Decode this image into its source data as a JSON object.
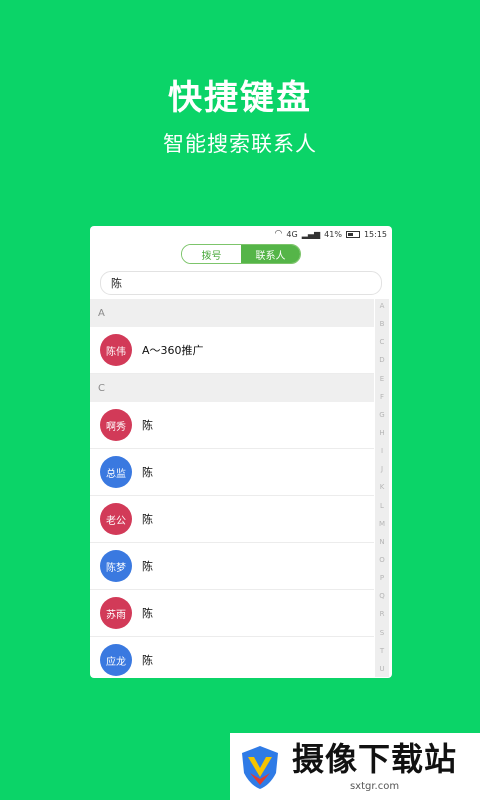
{
  "hero": {
    "title": "快捷键盘",
    "subtitle": "智能搜索联系人"
  },
  "status_bar": {
    "network": "4G",
    "battery": "41%",
    "time": "15:15"
  },
  "tabs": [
    {
      "label": "拨号",
      "active": false
    },
    {
      "label": "联系人",
      "active": true
    }
  ],
  "search": {
    "value": "陈"
  },
  "sections": [
    {
      "letter": "A",
      "contacts": [
        {
          "avatar": "陈伟",
          "name": "A～360推广",
          "color": "#d23a58"
        }
      ]
    },
    {
      "letter": "C",
      "contacts": [
        {
          "avatar": "啊秀",
          "name": "陈",
          "color": "#d23a58"
        },
        {
          "avatar": "总监",
          "name": "陈",
          "color": "#3a79e0"
        },
        {
          "avatar": "老公",
          "name": "陈",
          "color": "#d23a58"
        },
        {
          "avatar": "陈梦",
          "name": "陈",
          "color": "#3a79e0"
        },
        {
          "avatar": "苏雨",
          "name": "陈",
          "color": "#d23a58"
        },
        {
          "avatar": "应龙",
          "name": "陈",
          "color": "#3a79e0"
        }
      ]
    }
  ],
  "index_letters": [
    "A",
    "B",
    "C",
    "D",
    "E",
    "F",
    "G",
    "H",
    "I",
    "J",
    "K",
    "L",
    "M",
    "N",
    "O",
    "P",
    "Q",
    "R",
    "S",
    "T",
    "U"
  ],
  "watermark": {
    "name": "摄像下载站",
    "url": "sxtgr.com"
  },
  "colors": {
    "background": "#0bd468",
    "accent": "#55b548",
    "avatar_red": "#d23a58",
    "avatar_blue": "#3a79e0"
  }
}
